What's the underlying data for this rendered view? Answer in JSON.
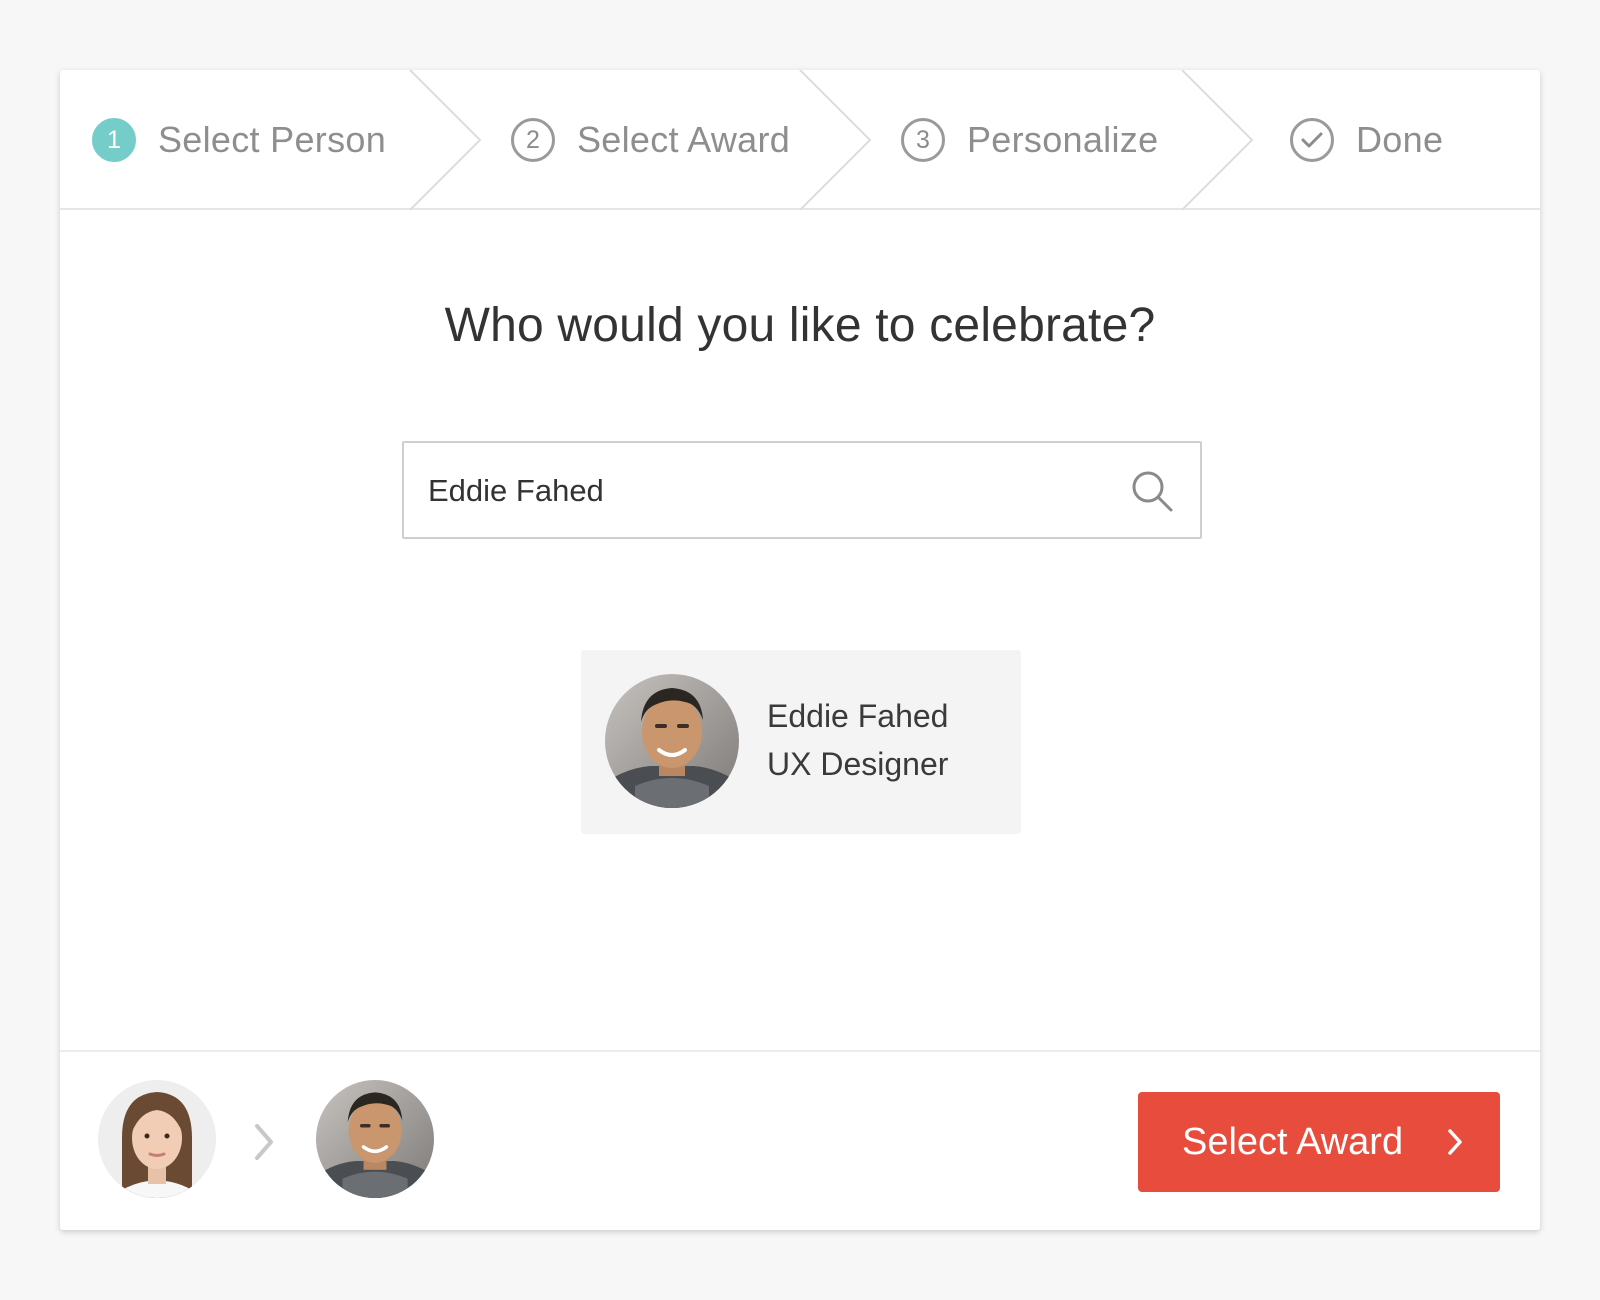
{
  "stepper": {
    "steps": [
      {
        "number": "1",
        "label": "Select Person",
        "state": "active"
      },
      {
        "number": "2",
        "label": "Select Award",
        "state": "upcoming"
      },
      {
        "number": "3",
        "label": "Personalize",
        "state": "upcoming"
      },
      {
        "number": "",
        "label": "Done",
        "state": "upcoming",
        "icon": "check-circle-icon"
      }
    ]
  },
  "main": {
    "title": "Who would you like to celebrate?",
    "search": {
      "value": "Eddie Fahed",
      "placeholder": "",
      "icon": "search-icon"
    },
    "result": {
      "name": "Eddie Fahed",
      "role": "UX Designer"
    }
  },
  "footer": {
    "next_button_label": "Select Award",
    "next_button_icon": "chevron-right-icon"
  },
  "colors": {
    "accent": "#74cdc8",
    "primary_button": "#e84c3d",
    "muted_text": "#8e8e8e"
  }
}
